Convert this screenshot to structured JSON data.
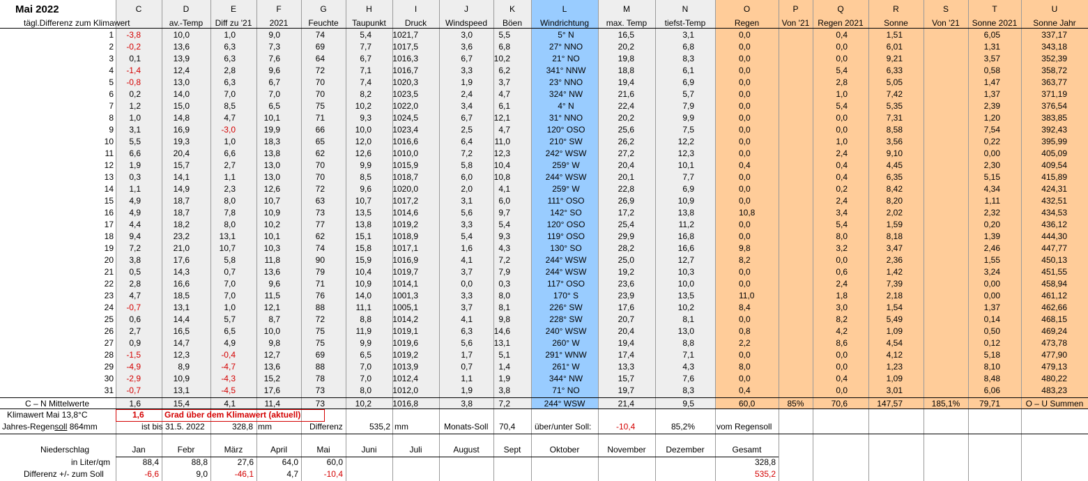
{
  "title": "Mai 2022",
  "column_letters": [
    "C",
    "D",
    "E",
    "F",
    "G",
    "H",
    "I",
    "J",
    "K",
    "L",
    "M",
    "N",
    "O",
    "P",
    "Q",
    "R",
    "S",
    "T",
    "U"
  ],
  "row_header_label": "tägl.Differenz zum Klimawert",
  "column_headers": [
    "av.-Temp",
    "Diff zu '21",
    "2021",
    "Feuchte",
    "Taupunkt",
    "Druck",
    "Windspeed",
    "Böen",
    "Windrichtung",
    "max. Temp",
    "tiefst-Temp",
    "Regen",
    "Von '21",
    "Regen 2021",
    "Sonne",
    "Von '21",
    "Sonne 2021",
    "Sonne Jahr"
  ],
  "rows": [
    [
      "1",
      "-3,8",
      "10,0",
      "1,0",
      "9,0",
      "74",
      "5,4",
      "1021,7",
      "3,0",
      "5,5",
      "5° N",
      "16,5",
      "3,1",
      "0,0",
      "",
      "0,4",
      "1,51",
      "",
      "6,05",
      "337,17"
    ],
    [
      "2",
      "-0,2",
      "13,6",
      "6,3",
      "7,3",
      "69",
      "7,7",
      "1017,5",
      "3,6",
      "6,8",
      "27° NNO",
      "20,2",
      "6,8",
      "0,0",
      "",
      "0,0",
      "6,01",
      "",
      "1,31",
      "343,18"
    ],
    [
      "3",
      "0,1",
      "13,9",
      "6,3",
      "7,6",
      "64",
      "6,7",
      "1016,3",
      "6,7",
      "10,2",
      "21° NO",
      "19,8",
      "8,3",
      "0,0",
      "",
      "0,0",
      "9,21",
      "",
      "3,57",
      "352,39"
    ],
    [
      "4",
      "-1,4",
      "12,4",
      "2,8",
      "9,6",
      "72",
      "7,1",
      "1016,7",
      "3,3",
      "6,2",
      "341° NNW",
      "18,8",
      "6,1",
      "0,0",
      "",
      "5,4",
      "6,33",
      "",
      "0,58",
      "358,72"
    ],
    [
      "5",
      "-0,8",
      "13,0",
      "6,3",
      "6,7",
      "70",
      "7,4",
      "1020,3",
      "1,9",
      "3,7",
      "23° NNO",
      "19,4",
      "6,9",
      "0,0",
      "",
      "2,8",
      "5,05",
      "",
      "1,47",
      "363,77"
    ],
    [
      "6",
      "0,2",
      "14,0",
      "7,0",
      "7,0",
      "70",
      "8,2",
      "1023,5",
      "2,4",
      "4,7",
      "324° NW",
      "21,6",
      "5,7",
      "0,0",
      "",
      "1,0",
      "7,42",
      "",
      "1,37",
      "371,19"
    ],
    [
      "7",
      "1,2",
      "15,0",
      "8,5",
      "6,5",
      "75",
      "10,2",
      "1022,0",
      "3,4",
      "6,1",
      "4° N",
      "22,4",
      "7,9",
      "0,0",
      "",
      "5,4",
      "5,35",
      "",
      "2,39",
      "376,54"
    ],
    [
      "8",
      "1,0",
      "14,8",
      "4,7",
      "10,1",
      "71",
      "9,3",
      "1024,5",
      "6,7",
      "12,1",
      "31° NNO",
      "20,2",
      "9,9",
      "0,0",
      "",
      "0,0",
      "7,31",
      "",
      "1,20",
      "383,85"
    ],
    [
      "9",
      "3,1",
      "16,9",
      "-3,0",
      "19,9",
      "66",
      "10,0",
      "1023,4",
      "2,5",
      "4,7",
      "120° OSO",
      "25,6",
      "7,5",
      "0,0",
      "",
      "0,0",
      "8,58",
      "",
      "7,54",
      "392,43"
    ],
    [
      "10",
      "5,5",
      "19,3",
      "1,0",
      "18,3",
      "65",
      "12,0",
      "1016,6",
      "6,4",
      "11,0",
      "210° SW",
      "26,2",
      "12,2",
      "0,0",
      "",
      "1,0",
      "3,56",
      "",
      "0,22",
      "395,99"
    ],
    [
      "11",
      "6,6",
      "20,4",
      "6,6",
      "13,8",
      "62",
      "12,6",
      "1010,0",
      "7,2",
      "12,3",
      "242° WSW",
      "27,2",
      "12,3",
      "0,0",
      "",
      "2,4",
      "9,10",
      "",
      "0,00",
      "405,09"
    ],
    [
      "12",
      "1,9",
      "15,7",
      "2,7",
      "13,0",
      "70",
      "9,9",
      "1015,9",
      "5,8",
      "10,4",
      "259° W",
      "20,4",
      "10,1",
      "0,4",
      "",
      "0,4",
      "4,45",
      "",
      "2,30",
      "409,54"
    ],
    [
      "13",
      "0,3",
      "14,1",
      "1,1",
      "13,0",
      "70",
      "8,5",
      "1018,7",
      "6,0",
      "10,8",
      "244° WSW",
      "20,1",
      "7,7",
      "0,0",
      "",
      "0,4",
      "6,35",
      "",
      "5,15",
      "415,89"
    ],
    [
      "14",
      "1,1",
      "14,9",
      "2,3",
      "12,6",
      "72",
      "9,6",
      "1020,0",
      "2,0",
      "4,1",
      "259° W",
      "22,8",
      "6,9",
      "0,0",
      "",
      "0,2",
      "8,42",
      "",
      "4,34",
      "424,31"
    ],
    [
      "15",
      "4,9",
      "18,7",
      "8,0",
      "10,7",
      "63",
      "10,7",
      "1017,2",
      "3,1",
      "6,0",
      "111° OSO",
      "26,9",
      "10,9",
      "0,0",
      "",
      "2,4",
      "8,20",
      "",
      "1,11",
      "432,51"
    ],
    [
      "16",
      "4,9",
      "18,7",
      "7,8",
      "10,9",
      "73",
      "13,5",
      "1014,6",
      "5,6",
      "9,7",
      "142° SO",
      "17,2",
      "13,8",
      "10,8",
      "",
      "3,4",
      "2,02",
      "",
      "2,32",
      "434,53"
    ],
    [
      "17",
      "4,4",
      "18,2",
      "8,0",
      "10,2",
      "77",
      "13,8",
      "1019,2",
      "3,3",
      "5,4",
      "120° OSO",
      "25,4",
      "11,2",
      "0,0",
      "",
      "5,4",
      "1,59",
      "",
      "0,20",
      "436,12"
    ],
    [
      "18",
      "9,4",
      "23,2",
      "13,1",
      "10,1",
      "62",
      "15,1",
      "1018,9",
      "5,4",
      "9,3",
      "119° OSO",
      "29,9",
      "16,8",
      "0,0",
      "",
      "8,0",
      "8,18",
      "",
      "1,39",
      "444,30"
    ],
    [
      "19",
      "7,2",
      "21,0",
      "10,7",
      "10,3",
      "74",
      "15,8",
      "1017,1",
      "1,6",
      "4,3",
      "130° SO",
      "28,2",
      "16,6",
      "9,8",
      "",
      "3,2",
      "3,47",
      "",
      "2,46",
      "447,77"
    ],
    [
      "20",
      "3,8",
      "17,6",
      "5,8",
      "11,8",
      "90",
      "15,9",
      "1016,9",
      "4,1",
      "7,2",
      "244° WSW",
      "25,0",
      "12,7",
      "8,2",
      "",
      "0,0",
      "2,36",
      "",
      "1,55",
      "450,13"
    ],
    [
      "21",
      "0,5",
      "14,3",
      "0,7",
      "13,6",
      "79",
      "10,4",
      "1019,7",
      "3,7",
      "7,9",
      "244° WSW",
      "19,2",
      "10,3",
      "0,0",
      "",
      "0,6",
      "1,42",
      "",
      "3,24",
      "451,55"
    ],
    [
      "22",
      "2,8",
      "16,6",
      "7,0",
      "9,6",
      "71",
      "10,9",
      "1014,1",
      "0,0",
      "0,3",
      "117° OSO",
      "23,6",
      "10,0",
      "0,0",
      "",
      "2,4",
      "7,39",
      "",
      "0,00",
      "458,94"
    ],
    [
      "23",
      "4,7",
      "18,5",
      "7,0",
      "11,5",
      "76",
      "14,0",
      "1001,3",
      "3,3",
      "8,0",
      "170° S",
      "23,9",
      "13,5",
      "11,0",
      "",
      "1,8",
      "2,18",
      "",
      "0,00",
      "461,12"
    ],
    [
      "24",
      "-0,7",
      "13,1",
      "1,0",
      "12,1",
      "88",
      "11,1",
      "1005,1",
      "3,7",
      "8,1",
      "226° SW",
      "17,6",
      "10,2",
      "8,4",
      "",
      "3,0",
      "1,54",
      "",
      "1,37",
      "462,66"
    ],
    [
      "25",
      "0,6",
      "14,4",
      "5,7",
      "8,7",
      "72",
      "8,8",
      "1014,2",
      "4,1",
      "9,8",
      "228° SW",
      "20,7",
      "8,1",
      "0,0",
      "",
      "8,2",
      "5,49",
      "",
      "0,14",
      "468,15"
    ],
    [
      "26",
      "2,7",
      "16,5",
      "6,5",
      "10,0",
      "75",
      "11,9",
      "1019,1",
      "6,3",
      "14,6",
      "240° WSW",
      "20,4",
      "13,0",
      "0,8",
      "",
      "4,2",
      "1,09",
      "",
      "0,50",
      "469,24"
    ],
    [
      "27",
      "0,9",
      "14,7",
      "4,9",
      "9,8",
      "75",
      "9,9",
      "1019,6",
      "5,6",
      "13,1",
      "260° W",
      "19,4",
      "8,8",
      "2,2",
      "",
      "8,6",
      "4,54",
      "",
      "0,12",
      "473,78"
    ],
    [
      "28",
      "-1,5",
      "12,3",
      "-0,4",
      "12,7",
      "69",
      "6,5",
      "1019,2",
      "1,7",
      "5,1",
      "291° WNW",
      "17,4",
      "7,1",
      "0,0",
      "",
      "0,0",
      "4,12",
      "",
      "5,18",
      "477,90"
    ],
    [
      "29",
      "-4,9",
      "8,9",
      "-4,7",
      "13,6",
      "88",
      "7,0",
      "1013,9",
      "0,7",
      "1,4",
      "261° W",
      "13,3",
      "4,3",
      "8,0",
      "",
      "0,0",
      "1,23",
      "",
      "8,10",
      "479,13"
    ],
    [
      "30",
      "-2,9",
      "10,9",
      "-4,3",
      "15,2",
      "78",
      "7,0",
      "1012,4",
      "1,1",
      "1,9",
      "344° NW",
      "15,7",
      "7,6",
      "0,0",
      "",
      "0,4",
      "1,09",
      "",
      "8,48",
      "480,22"
    ],
    [
      "31",
      "-0,7",
      "13,1",
      "-4,5",
      "17,6",
      "73",
      "8,0",
      "1012,0",
      "1,9",
      "3,8",
      "71° NO",
      "19,7",
      "8,3",
      "0,4",
      "",
      "0,0",
      "3,01",
      "",
      "6,06",
      "483,23"
    ]
  ],
  "means_row": [
    "C – N Mittelwerte",
    "1,6",
    "15,4",
    "4,1",
    "11,4",
    "73",
    "10,2",
    "1016,8",
    "3,8",
    "7,2",
    "244° WSW",
    "21,4",
    "9,5",
    "60,0",
    "85%",
    "70,6",
    "147,57",
    "185,1%",
    "79,71",
    "O – U Summen"
  ],
  "klima": {
    "label": "Klimawert Mai 13,8°C",
    "value": "1,6",
    "text": "Grad über dem Klimawert (aktuell)"
  },
  "regensoll": {
    "label_pre": "Jahres-Regen",
    "label_u": "soll",
    "label_post": " 864mm",
    "ist_bis": "ist bis 31.5. 2022",
    "ist_value": "328,8",
    "ist_unit": "mm",
    "diff_label": "Differenz",
    "diff_value": "535,2",
    "diff_unit": "mm",
    "monats_label": "Monats-Soll",
    "monats_value": "70,4",
    "ueber_label": "über/unter Soll:",
    "ueber_value": "-10,4",
    "pct_value": "85,2%",
    "vom_label": "vom Regensoll"
  },
  "niederschlag": {
    "label1": "Niederschlag",
    "label2": "in Liter/qm",
    "label3": "Differenz  +/- zum Soll",
    "months": [
      "Jan",
      "Febr",
      "März",
      "April",
      "Mai",
      "Juni",
      "Juli",
      "August",
      "Sept",
      "Oktober",
      "November",
      "Dezember",
      "Gesamt"
    ],
    "values": [
      "88,4",
      "88,8",
      "27,6",
      "64,0",
      "60,0",
      "",
      "",
      "",
      "",
      "",
      "",
      "",
      "328,8"
    ],
    "diffs": [
      "-6,6",
      "9,0",
      "-46,1",
      "4,7",
      "-10,4",
      "",
      "",
      "",
      "",
      "",
      "",
      "",
      "535,2"
    ]
  }
}
